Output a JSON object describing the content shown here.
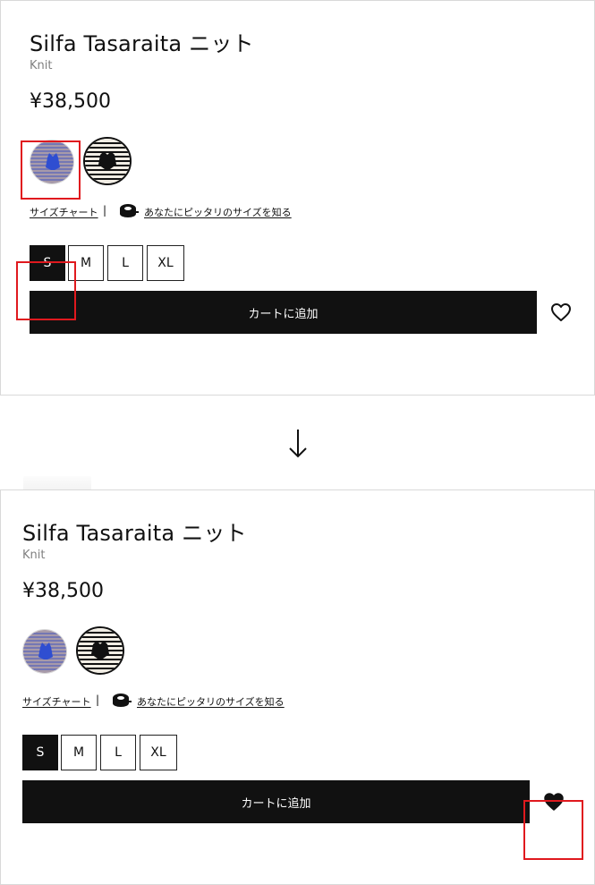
{
  "product": {
    "title": "Silfa Tasaraita ニット",
    "subtitle": "Knit",
    "price": "¥38,500"
  },
  "swatches": [
    {
      "name": "blue-stripe",
      "selected_before": true
    },
    {
      "name": "black-white-stripe",
      "selected_before": false
    }
  ],
  "size_tools": {
    "size_chart_label": "サイズチャート",
    "separator": "|",
    "fit_label": "あなたにピッタリのサイズを知る",
    "icon": "tape-measure-icon"
  },
  "sizes": [
    "S",
    "M",
    "L",
    "XL"
  ],
  "selected_size": "S",
  "cart": {
    "add_label": "カートに追加"
  },
  "favorite": {
    "before": "heart-outline-icon",
    "after": "heart-filled-icon"
  },
  "transition": {
    "icon": "down-arrow-icon"
  },
  "colors": {
    "accent": "#e0191e",
    "button": "#111111"
  }
}
